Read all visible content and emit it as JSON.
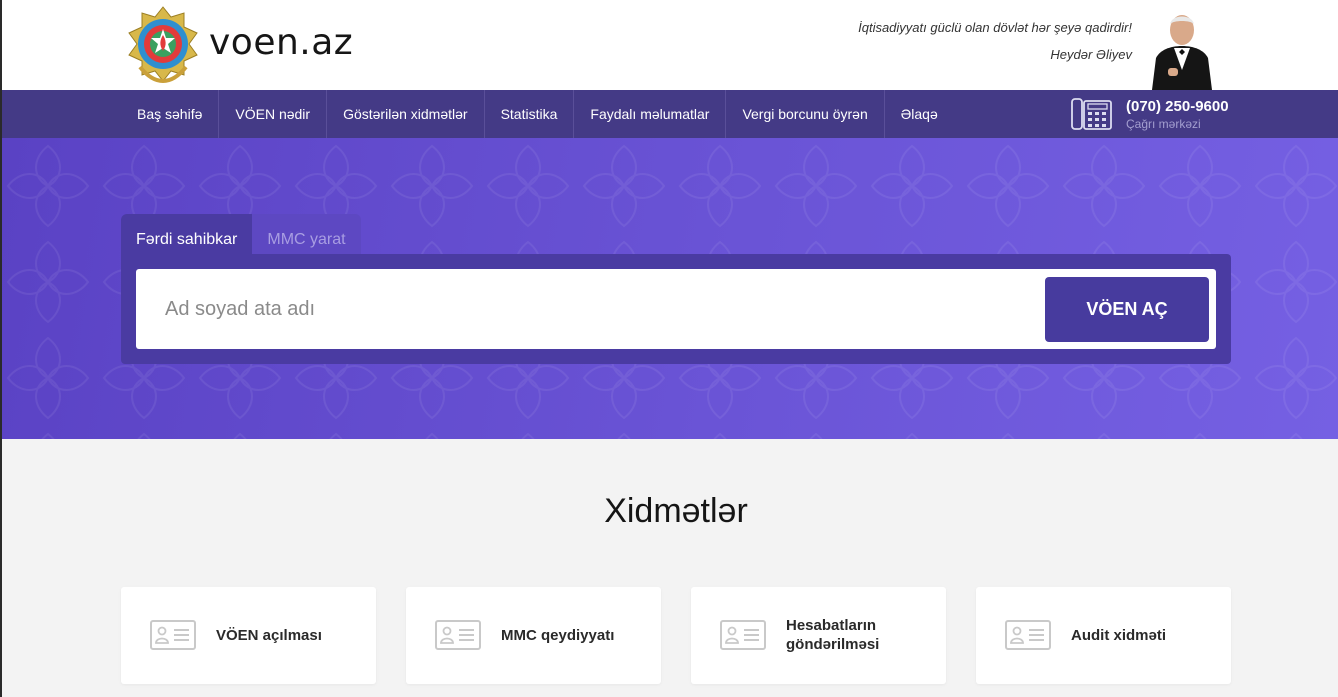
{
  "header": {
    "brand": "voen.az",
    "quote": "İqtisadiyyatı güclü olan dövlət hər şeyə qadirdir!",
    "author": "Heydər Əliyev"
  },
  "nav": {
    "items": [
      "Baş səhifə",
      "VÖEN nədir",
      "Göstərilən xidmətlər",
      "Statistika",
      "Faydalı məlumatlar",
      "Vergi borcunu öyrən",
      "Əlaqə"
    ]
  },
  "contact": {
    "phone": "(070) 250-9600",
    "label": "Çağrı mərkəzi"
  },
  "hero": {
    "tabs": [
      "Fərdi sahibkar",
      "MMC yarat"
    ],
    "search_placeholder": "Ad soyad ata adı",
    "button_label": "VÖEN AÇ"
  },
  "services": {
    "title": "Xidmətlər",
    "cards": [
      "VÖEN açılması",
      "MMC qeydiyyatı",
      "Hesabatların göndərilməsi",
      "Audit xidməti"
    ]
  },
  "colors": {
    "nav_bg": "#443a86",
    "hero_start": "#5a42c4",
    "hero_end": "#7560e3",
    "button_bg": "#473b9e"
  }
}
